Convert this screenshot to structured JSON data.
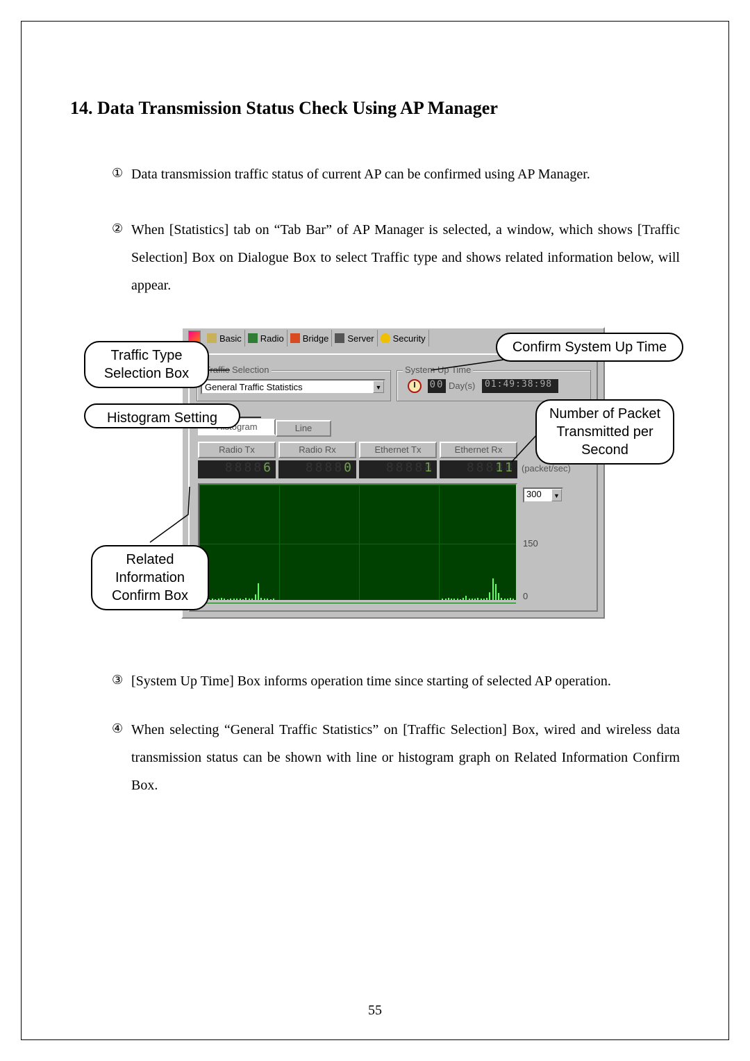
{
  "heading": "14. Data Transmission Status Check Using AP Manager",
  "items": {
    "i1": "Data transmission traffic status of current AP can be confirmed using AP Manager.",
    "i2": "When [Statistics] tab on “Tab Bar” of AP Manager is selected, a window, which shows   [Traffic Selection] Box on Dialogue Box to select Traffic type and shows related information below, will appear.",
    "i3": "[System Up Time] Box informs operation time since starting of selected AP operation.",
    "i4": "When selecting “General Traffic Statistics” on [Traffic Selection] Box, wired and wireless data transmission status can be shown with line or histogram graph on Related Information Confirm Box."
  },
  "markers": {
    "m1": "①",
    "m2": "②",
    "m3": "③",
    "m4": "④"
  },
  "callouts": {
    "traffic": "Traffic Type Selection Box",
    "hist": "Histogram Setting",
    "uptime": "Confirm System Up Time",
    "packet": "Number of Packet Transmitted per Second",
    "related": "Related Information Confirm Box"
  },
  "app": {
    "tabs": {
      "basic": "Basic",
      "radio": "Radio",
      "bridge": "Bridge",
      "server": "Server",
      "security": "Security"
    },
    "trafficSelection": {
      "title": "Traffic Selection",
      "value": "General Traffic Statistics"
    },
    "systemUpTime": {
      "title": "System Up Time",
      "days_lcd": "00",
      "days_label": "Day(s)",
      "time_lcd": "01:49:38:98"
    },
    "viewTabs": {
      "histogram": "Histogram",
      "line": "Line"
    },
    "columns": {
      "c1": "Radio Tx",
      "c2": "Radio Rx",
      "c3": "Ethernet Tx",
      "c4": "Ethernet Rx"
    },
    "counters": {
      "c1": "6",
      "c2": "0",
      "c3": "1",
      "c4": "11"
    },
    "unit": "(packet/sec)",
    "scale": "300",
    "midTick": "150",
    "zeroTick": "0"
  },
  "chart_data": {
    "type": "bar",
    "title": "",
    "xlabel": "",
    "ylabel": "packet/sec",
    "ylim": [
      0,
      300
    ],
    "series": [
      {
        "name": "Radio Tx",
        "values": [
          5,
          3,
          2,
          4,
          2,
          3,
          5,
          4,
          2,
          3,
          4,
          4,
          3,
          2,
          5,
          3,
          4,
          15,
          42,
          5,
          4,
          3,
          2,
          3
        ]
      },
      {
        "name": "Radio Rx",
        "values": []
      },
      {
        "name": "Ethernet Tx",
        "values": []
      },
      {
        "name": "Ethernet Rx",
        "values": [
          4,
          3,
          5,
          3,
          4,
          3,
          2,
          5,
          10,
          3,
          4,
          3,
          5,
          4,
          3,
          5,
          20,
          55,
          40,
          18,
          5,
          4,
          3,
          5,
          4
        ]
      }
    ]
  },
  "pageNumber": "55"
}
